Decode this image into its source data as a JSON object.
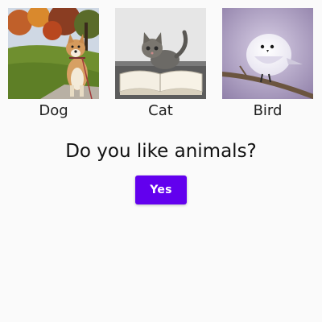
{
  "animals": [
    {
      "label": "Dog",
      "icon": "dog-photo"
    },
    {
      "label": "Cat",
      "icon": "cat-photo"
    },
    {
      "label": "Bird",
      "icon": "bird-photo"
    }
  ],
  "prompt": {
    "question": "Do you like animals?"
  },
  "actions": {
    "yes_label": "Yes"
  },
  "colors": {
    "accent": "#6200ee",
    "background": "#fafafa",
    "button_text": "#ffffff"
  }
}
